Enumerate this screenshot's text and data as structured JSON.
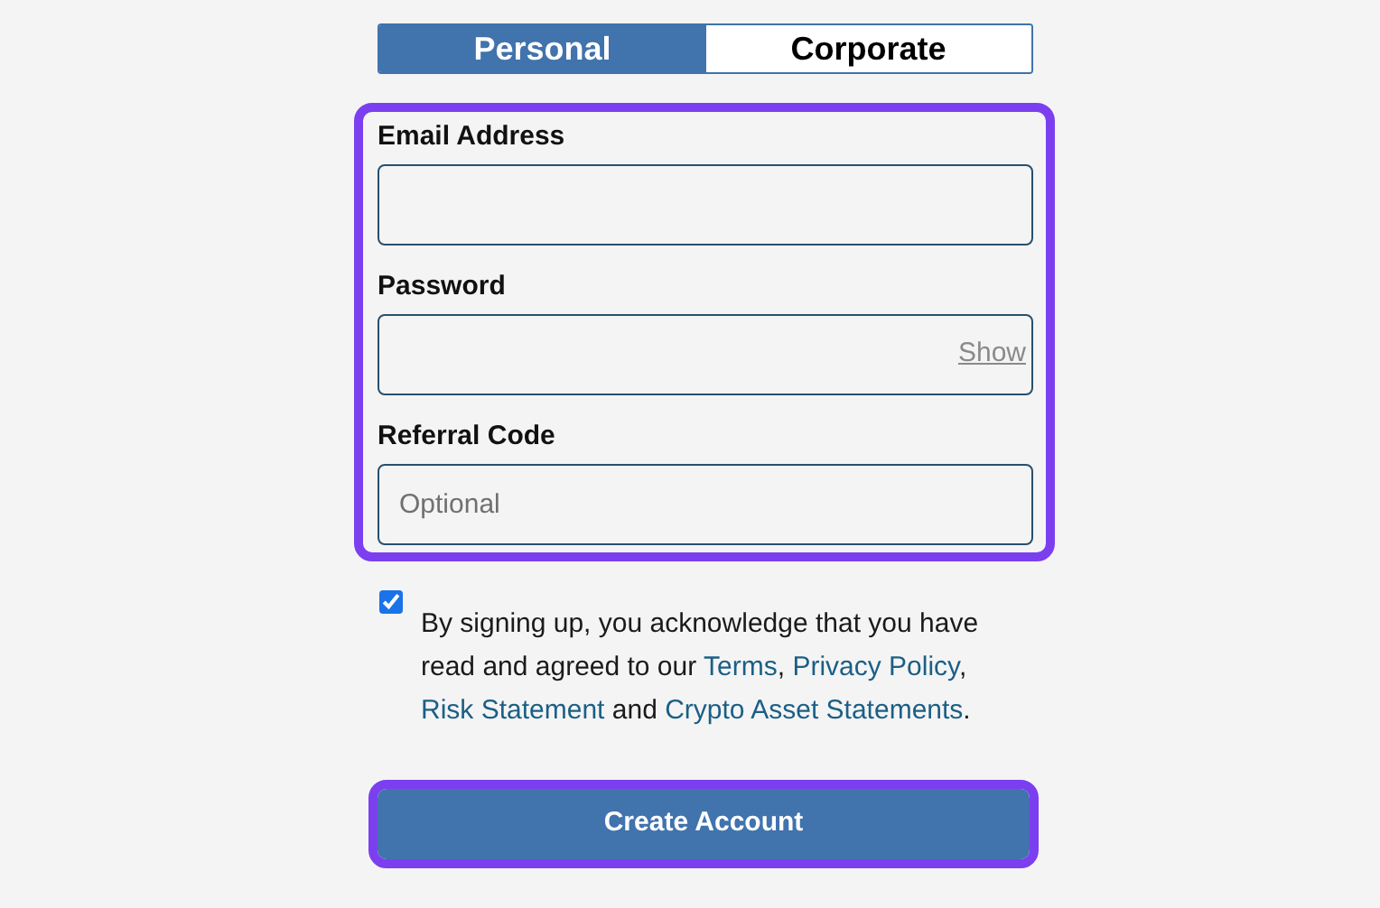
{
  "tabs": [
    {
      "label": "Personal",
      "selected": true
    },
    {
      "label": "Corporate",
      "selected": false
    }
  ],
  "fields": [
    {
      "label": "Email Address"
    },
    {
      "label": "Password",
      "action": "Show"
    },
    {
      "label": "Referral Code",
      "placeholder": "Optional"
    }
  ],
  "consent": {
    "checked": true,
    "parts": [
      {
        "kind": "text",
        "text": "By signing up, you acknowledge that you have read and agreed to our "
      },
      {
        "kind": "link",
        "text": "Terms"
      },
      {
        "kind": "text",
        "text": ", "
      },
      {
        "kind": "link",
        "text": "Privacy Policy"
      },
      {
        "kind": "text",
        "text": ", "
      },
      {
        "kind": "link",
        "text": "Risk Statement"
      },
      {
        "kind": "text",
        "text": " and "
      },
      {
        "kind": "link",
        "text": "Crypto Asset Statements"
      },
      {
        "kind": "text",
        "text": "."
      }
    ]
  },
  "submit_button": "Create Account"
}
